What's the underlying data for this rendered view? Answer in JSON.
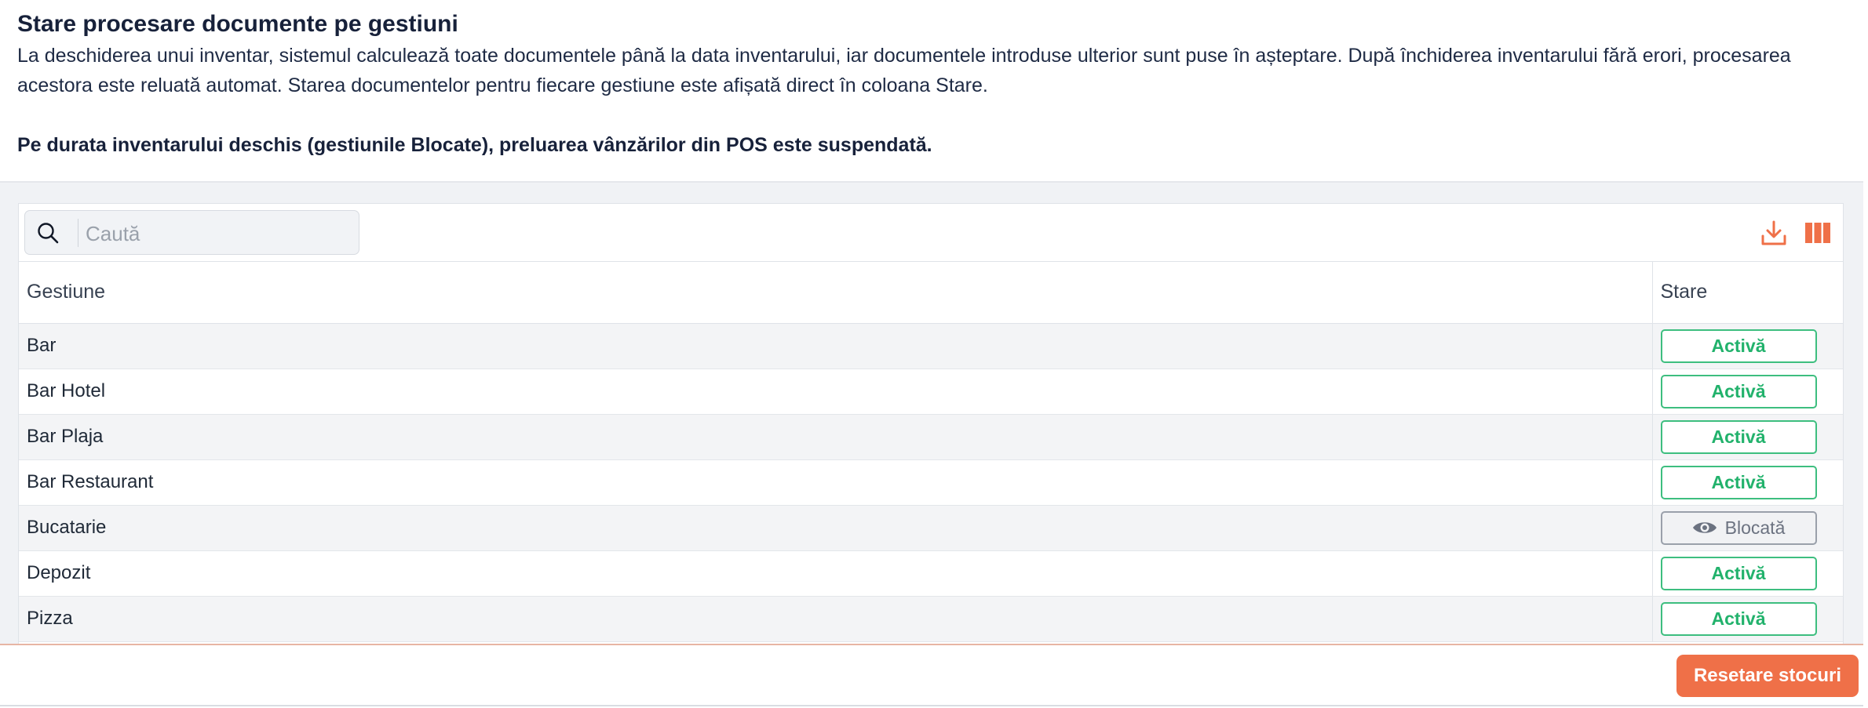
{
  "header": {
    "title": "Stare procesare documente pe gestiuni",
    "description": "La deschiderea unui inventar, sistemul calculează toate documentele până la data inventarului, iar documentele introduse ulterior sunt puse în așteptare. După închiderea inventarului fără erori, procesarea acestora este reluată automat. Starea documentelor pentru fiecare gestiune este afișată direct în coloana Stare.",
    "note": "Pe durata inventarului deschis (gestiunile Blocate), preluarea vânzărilor din POS este suspendată."
  },
  "toolbar": {
    "search_placeholder": "Caută",
    "search_value": "",
    "icons": [
      "search-icon",
      "download-icon",
      "columns-icon"
    ],
    "accent_color": "#ef7048"
  },
  "table": {
    "columns": [
      "Gestiune",
      "Stare"
    ],
    "rows": [
      {
        "gestiune": "Bar",
        "stare": "Activă",
        "status": "active"
      },
      {
        "gestiune": "Bar Hotel",
        "stare": "Activă",
        "status": "active"
      },
      {
        "gestiune": "Bar Plaja",
        "stare": "Activă",
        "status": "active"
      },
      {
        "gestiune": "Bar Restaurant",
        "stare": "Activă",
        "status": "active"
      },
      {
        "gestiune": "Bucatarie",
        "stare": "Blocată",
        "status": "blocked",
        "icon": "eye-icon"
      },
      {
        "gestiune": "Depozit",
        "stare": "Activă",
        "status": "active"
      },
      {
        "gestiune": "Pizza",
        "stare": "Activă",
        "status": "active"
      }
    ],
    "status_colors": {
      "active": "#22b26c",
      "blocked": "#6b7280"
    }
  },
  "footer": {
    "reset_label": "Resetare stocuri",
    "reset_color": "#ef7048"
  }
}
